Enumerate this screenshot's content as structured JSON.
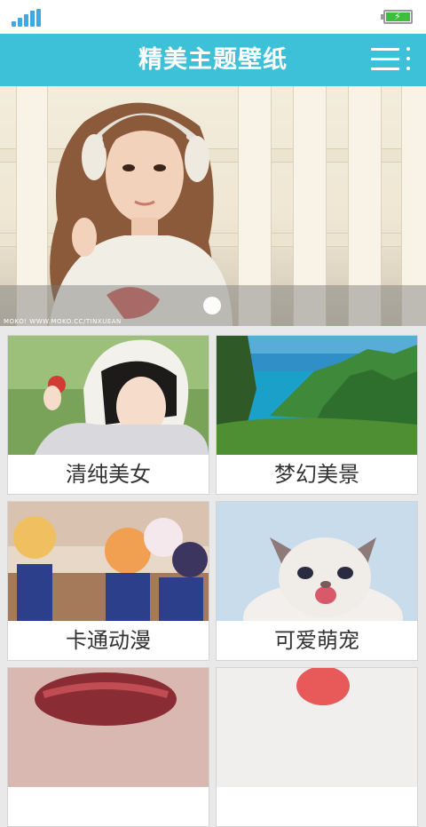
{
  "app": {
    "title": "精美主题壁纸"
  },
  "status_bar": {
    "signal_icon": "signal-icon",
    "battery_icon": "battery-charging-icon"
  },
  "header": {
    "menu_icon": "menu-icon"
  },
  "banner": {
    "credit": "MOKO! WWW.MOKO.CC/TINXUEAN",
    "slides": 1,
    "active_index": 0
  },
  "categories": [
    {
      "label": "清纯美女"
    },
    {
      "label": "梦幻美景"
    },
    {
      "label": "卡通动漫"
    },
    {
      "label": "可爱萌宠"
    },
    {
      "label": ""
    },
    {
      "label": ""
    }
  ],
  "colors": {
    "accent": "#3cc1d8",
    "background": "#e9e9e9"
  }
}
